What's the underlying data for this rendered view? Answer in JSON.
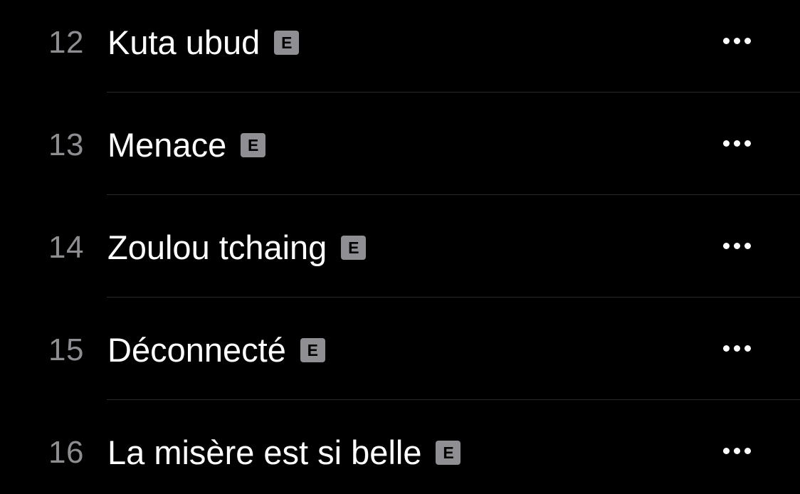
{
  "tracks": [
    {
      "number": "12",
      "title": "Kuta ubud",
      "explicit": "E",
      "more_icon": "ellipsis-icon"
    },
    {
      "number": "13",
      "title": "Menace",
      "explicit": "E",
      "more_icon": "ellipsis-icon"
    },
    {
      "number": "14",
      "title": "Zoulou tchaing",
      "explicit": "E",
      "more_icon": "ellipsis-icon"
    },
    {
      "number": "15",
      "title": "Déconnecté",
      "explicit": "E",
      "more_icon": "ellipsis-icon"
    },
    {
      "number": "16",
      "title": "La misère est si belle",
      "explicit": "E",
      "more_icon": "ellipsis-icon"
    }
  ],
  "colors": {
    "background": "#000000",
    "title": "#ffffff",
    "number": "#8d8d92",
    "badge": "#8e8e93",
    "separator": "#2a2a2c"
  }
}
